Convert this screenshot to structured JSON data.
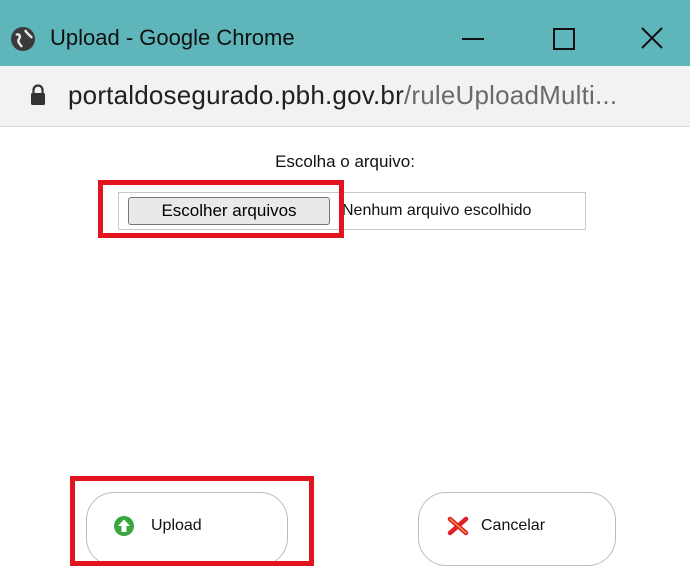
{
  "window": {
    "title": "Upload - Google Chrome",
    "icon": "globe-icon",
    "controls": [
      "minimize-icon",
      "maximize-icon",
      "close-icon"
    ]
  },
  "address_bar": {
    "url_domain": "portaldosegurado.pbh.gov.br",
    "url_path": "/ruleUploadMulti..."
  },
  "form": {
    "prompt": "Escolha o arquivo:",
    "choose_button": "Escolher arquivos",
    "no_file_text": "Nenhum arquivo escolhido"
  },
  "actions": {
    "upload_label": "Upload",
    "cancel_label": "Cancelar"
  },
  "colors": {
    "titlebar": "#5eb6bb",
    "highlight": "#e3141f",
    "upload_icon": "#3aa63f",
    "cancel_icon": "#e0202a"
  }
}
